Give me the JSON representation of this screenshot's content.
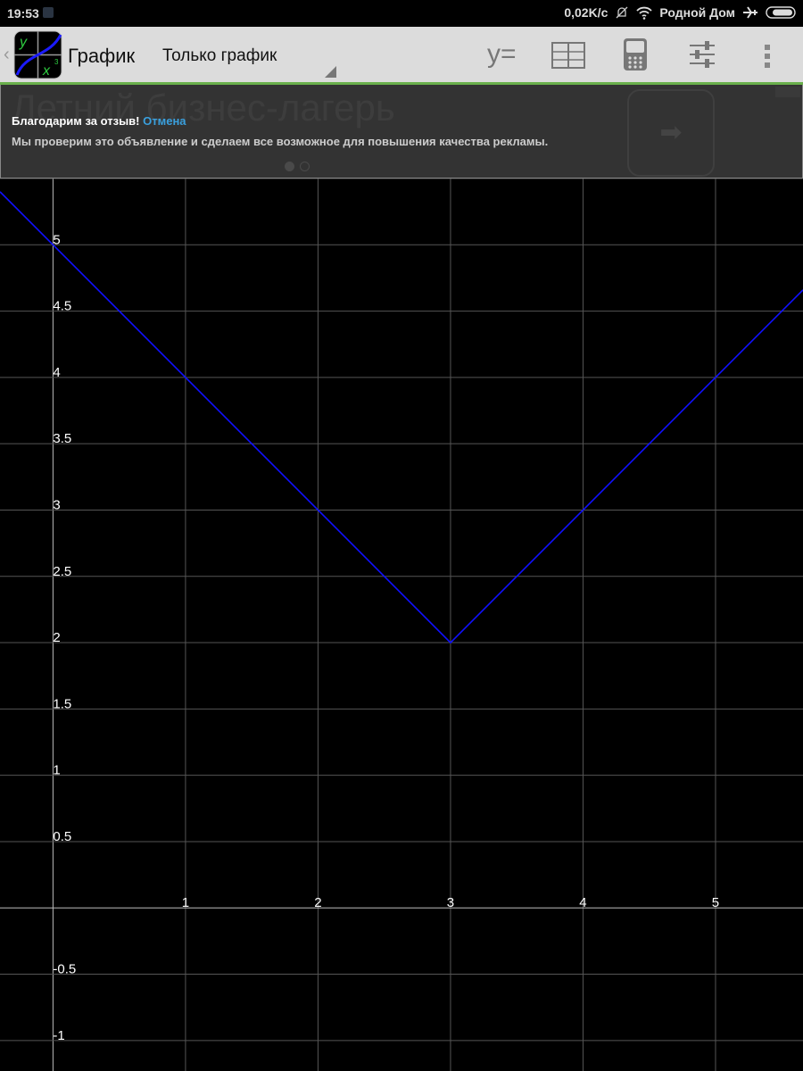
{
  "status_bar": {
    "time": "19:53",
    "net_speed": "0,02K/с",
    "network_name": "Родной Дом",
    "icons": [
      "notification-icon",
      "bell-muted-icon",
      "wifi-icon",
      "airplane-icon",
      "battery-icon"
    ]
  },
  "toolbar": {
    "title": "График",
    "mode_select": "Только график",
    "buttons": [
      "y=",
      "table-icon",
      "calculator-icon",
      "settings-sliders-icon",
      "overflow-menu-icon"
    ],
    "y_equals_label": "y=",
    "accent_color": "#6ab04c"
  },
  "ad_banner": {
    "background_title": "Летний бизнес-лагерь",
    "thanks_text": "Благодарим за отзыв!",
    "cancel_link": "Отмена",
    "message": "Мы проверим это объявление и сделаем все возможное для повышения качества рекламы."
  },
  "chart_data": {
    "type": "line",
    "function": "y = |x - 3| + 2",
    "series": [
      {
        "x": [
          -0.4,
          3,
          5.66
        ],
        "y": [
          5.4,
          2,
          4.66
        ],
        "color": "#1010ff"
      }
    ],
    "xlim": [
      -0.4,
      5.66
    ],
    "ylim": [
      -1.23,
      5.5
    ],
    "x_ticks": [
      "1",
      "2",
      "3",
      "4",
      "5"
    ],
    "y_ticks": [
      "-1",
      "-0.5",
      "0.5",
      "1",
      "1.5",
      "2",
      "2.5",
      "3",
      "3.5",
      "4",
      "4.5",
      "5"
    ],
    "grid": true,
    "background": "#000000"
  }
}
